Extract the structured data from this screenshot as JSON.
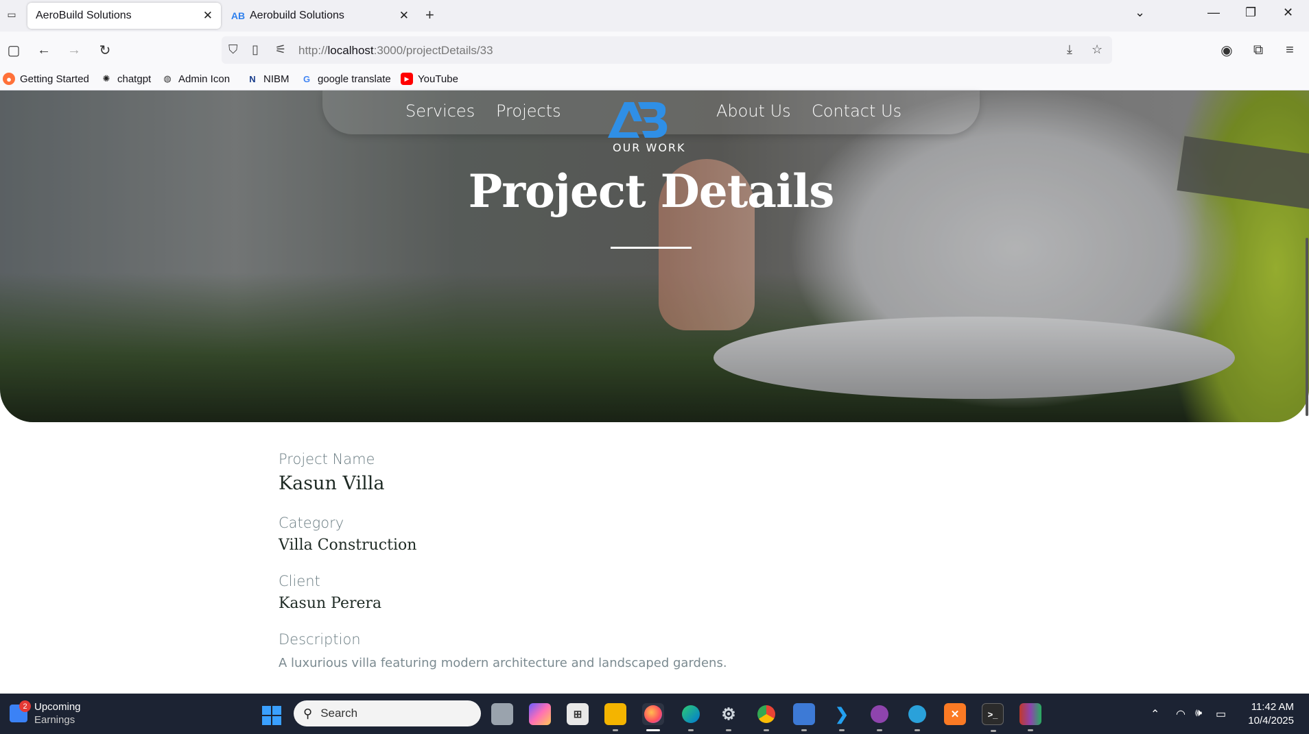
{
  "browser": {
    "tabs": [
      {
        "title": "AeroBuild Solutions",
        "active": true
      },
      {
        "title": "Aerobuild Solutions",
        "active": false
      }
    ],
    "url_host": "localhost",
    "url_prefix": "http://",
    "url_path": ":3000/projectDetails/33",
    "bookmarks": [
      {
        "label": "Getting Started",
        "icon": "firefox-icon"
      },
      {
        "label": "chatgpt",
        "icon": "openai-icon"
      },
      {
        "label": "Admin Icon",
        "icon": "globe-icon"
      },
      {
        "label": "NIBM",
        "icon": "nibm-icon"
      },
      {
        "label": "google translate",
        "icon": "google-icon"
      },
      {
        "label": "YouTube",
        "icon": "youtube-icon"
      }
    ]
  },
  "site": {
    "nav": [
      "Services",
      "Projects",
      "About Us",
      "Contact Us"
    ],
    "logo_text": "AB",
    "logo_subtitle": "OUR WORK",
    "hero_title": "Project Details"
  },
  "project": {
    "name_label": "Project Name",
    "name": "Kasun Villa",
    "category_label": "Category",
    "category": "Villa Construction",
    "client_label": "Client",
    "client": "Kasun Perera",
    "description_label": "Description",
    "description": "A luxurious villa featuring modern architecture and landscaped gardens."
  },
  "taskbar": {
    "widget_badge": "2",
    "widget_title": "Upcoming",
    "widget_subtitle": "Earnings",
    "search_placeholder": "Search",
    "time": "11:42 AM",
    "date": "10/4/2025"
  }
}
